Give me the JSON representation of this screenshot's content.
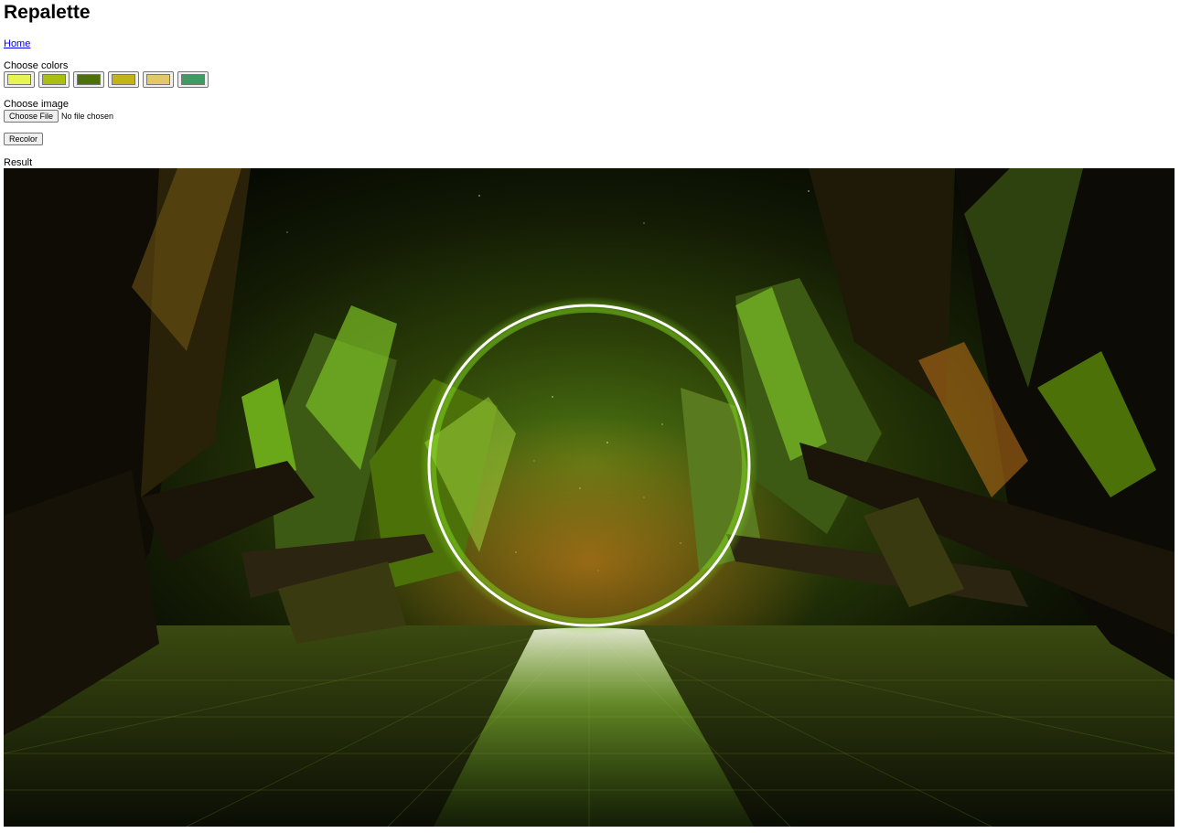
{
  "page": {
    "title": "Repalette",
    "nav": {
      "home_label": "Home"
    }
  },
  "palette": {
    "label": "Choose colors",
    "colors": [
      "#e7f553",
      "#a9c012",
      "#4d7109",
      "#c2b414",
      "#e3c86a",
      "#3f9a63"
    ]
  },
  "image_input": {
    "label": "Choose image",
    "button_label": "Choose File",
    "status_text": "No file chosen"
  },
  "actions": {
    "recolor_label": "Recolor"
  },
  "result": {
    "label": "Result",
    "scene_colors": {
      "ring": "#ffffff",
      "glow": "#7fd81e",
      "amber": "#c2761a",
      "crystal": "#3d5a14",
      "crystal_light": "#7cbf26",
      "shadow": "#120e06"
    }
  }
}
